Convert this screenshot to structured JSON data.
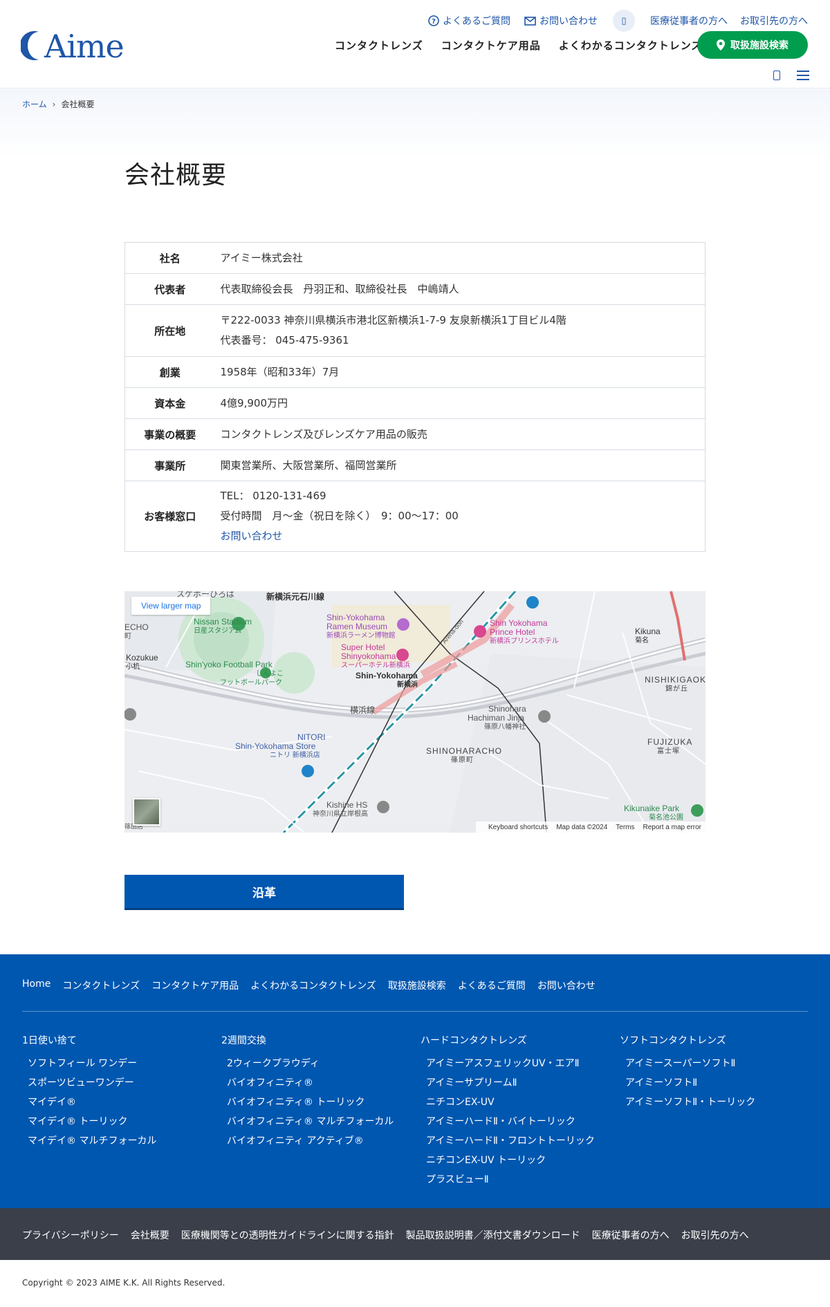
{
  "header": {
    "logo_text": "Aime",
    "util": {
      "faq": "よくあるご質問",
      "contact": "お問い合わせ",
      "round_icon": "▯",
      "medical": "医療従事者の方へ",
      "business": "お取引先の方へ"
    },
    "nav": [
      "コンタクトレンズ",
      "コンタクトケア用品",
      "よくわかるコンタクトレンズ"
    ],
    "search_btn": "取扱施設検索",
    "small_icon": "▯"
  },
  "breadcrumb": {
    "home": "ホーム",
    "sep": "›",
    "current": "会社概要"
  },
  "page_title": "会社概要",
  "table": {
    "name_h": "社名",
    "name_v": "アイミー株式会社",
    "rep_h": "代表者",
    "rep_v": "代表取締役会長　丹羽正和、取締役社長　中嶋靖人",
    "addr_h": "所在地",
    "addr_v1": "〒222-0033 神奈川県横浜市港北区新横浜1-7-9 友泉新横浜1丁目ビル4階",
    "addr_v2": "代表番号： 045-475-9361",
    "found_h": "創業",
    "found_v": "1958年（昭和33年）7月",
    "cap_h": "資本金",
    "cap_v": "4億9,900万円",
    "biz_h": "事業の概要",
    "biz_v": "コンタクトレンズ及びレンズケア用品の販売",
    "office_h": "事業所",
    "office_v": "関東営業所、大阪営業所、福岡営業所",
    "cust_h": "お客様窓口",
    "cust_v1": "TEL： 0120-131-469",
    "cust_v2": "受付時間　月～金（祝日を除く）　9：00～17：00",
    "cust_link": "お問い合わせ"
  },
  "map": {
    "view_larger": "View larger map",
    "labels": {
      "sports": "スケボーひろば",
      "road1": "新横浜元石川線",
      "echo1": "ECHO",
      "echo2": "町",
      "nissan": "Nissan Stadium",
      "nissan_ja": "日産スタジアム",
      "ramen": "Shin-Yokohama",
      "ramen2": "Ramen Museum",
      "ramen_ja": "新横浜ラーメン博物館",
      "super": "Super Hotel",
      "super2": "Shinyokohama",
      "super_ja": "スーパーホテル新横浜",
      "prince": "Shin Yokohama",
      "prince2": "Prince Hotel",
      "prince_ja": "新横浜プリンスホテル",
      "kikuna": "Kikuna",
      "kikuna_ja": "菊名",
      "kozukue": "Kozukue",
      "kozukue_ja": "小机",
      "football": "Shin'yoko Football Park",
      "football_ja": "しんよこ",
      "football_ja2": "フットボールパーク",
      "station": "Shin-Yokohama",
      "station_ja": "新横浜",
      "nishikigao": "NISHIKIGAOKA",
      "nishikigao_ja": "錦が丘",
      "yokohama_line": "横浜線",
      "shinohara": "Shinohara",
      "shinohara2": "Hachiman Jinja",
      "shinohara_ja": "篠原八幡神社",
      "nitori": "NITORI",
      "nitori2": "Shin-Yokohama Store",
      "nitori_ja": "ニトリ 新横浜店",
      "shinoharacho": "SHINOHARACHO",
      "shinoharacho_ja": "篠原町",
      "fujizuka": "FUJIZUKA",
      "fujizuka_ja": "富士塚",
      "kishine": "Kishine HS",
      "kishine_ja": "神奈川県立岸根高",
      "kikunaike": "Kikunaike Park",
      "kikunaike_ja": "菊名池公園",
      "arena": "Arena-dori",
      "misc": "篠原",
      "bottomleft": "篠田店"
    },
    "footer": [
      "Keyboard shortcuts",
      "Map data ©2024",
      "Terms",
      "Report a map error"
    ]
  },
  "history_btn": "沿革",
  "footer": {
    "nav": [
      "Home",
      "コンタクトレンズ",
      "コンタクトケア用品",
      "よくわかるコンタクトレンズ",
      "取扱施設検索",
      "よくあるご質問",
      "お問い合わせ"
    ],
    "col1": {
      "cat": "1日使い捨て",
      "items": [
        "ソフトフィール ワンデー",
        "スポーツビューワンデー",
        "マイデイ®",
        "マイデイ® トーリック",
        "マイデイ® マルチフォーカル"
      ]
    },
    "col2": {
      "cat": "2週間交換",
      "items": [
        "2ウィークプラウディ",
        "バイオフィニティ®",
        "バイオフィニティ® トーリック",
        "バイオフィニティ® マルチフォーカル",
        "バイオフィニティ アクティブ®"
      ]
    },
    "col3": {
      "cat": "ハードコンタクトレンズ",
      "items": [
        "アイミーアスフェリックUV・エアⅡ",
        "アイミーサプリームⅡ",
        "ニチコンEX-UV",
        "アイミーハードⅡ・バイトーリック",
        "アイミーハードⅡ・フロントトーリック",
        "ニチコンEX-UV トーリック",
        "プラスビューⅡ"
      ]
    },
    "col4": {
      "cat": "ソフトコンタクトレンズ",
      "items": [
        "アイミースーパーソフトⅡ",
        "アイミーソフトⅡ",
        "アイミーソフトⅡ・トーリック"
      ]
    },
    "bottom_links": [
      "プライバシーポリシー",
      "会社概要",
      "医療機関等との透明性ガイドラインに関する指針",
      "製品取扱説明書／添付文書ダウンロード",
      "医療従事者の方へ",
      "お取引先の方へ"
    ],
    "copyright": "Copyright © 2023 AIME K.K. All Rights Reserved."
  },
  "colors": {
    "brand_blue": "#0057b0",
    "search_green": "#009d4f",
    "dark_footer": "#3a3f4a"
  }
}
